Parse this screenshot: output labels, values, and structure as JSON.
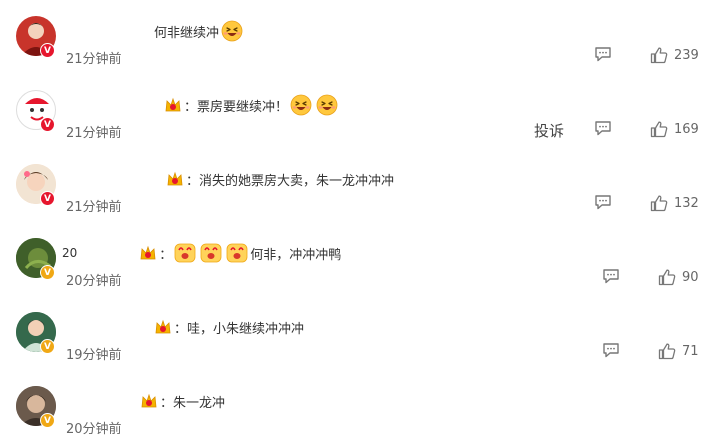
{
  "comments": [
    {
      "prefix": "",
      "text": "何非继续冲",
      "time": "21分钟前",
      "likes": "239",
      "badge": "V",
      "badge_color": "#e6162d"
    },
    {
      "prefix": "",
      "text": "：票房要继续冲！",
      "time": "21分钟前",
      "likes": "169",
      "badge": "V",
      "badge_color": "#e6162d",
      "report": "投诉"
    },
    {
      "prefix": "",
      "text": "：消失的她票房大卖，朱一龙冲冲冲",
      "time": "21分钟前",
      "likes": "132",
      "badge": "V",
      "badge_color": "#e6162d"
    },
    {
      "prefix": "20",
      "text": "：",
      "text2": "何非，冲冲冲鸭",
      "time": "20分钟前",
      "likes": "90",
      "badge": "V",
      "badge_color": "#f0a815"
    },
    {
      "prefix": "",
      "text": "：哇，小朱继续冲冲冲",
      "time": "19分钟前",
      "likes": "71",
      "badge": "V",
      "badge_color": "#f0a815"
    },
    {
      "prefix": "",
      "text": "：朱一龙冲",
      "time": "20分钟前",
      "badge": "V",
      "badge_color": "#f0a815"
    }
  ],
  "icons": {
    "reply": "comment-icon",
    "like": "thumb-up-icon",
    "emoji": "laughing-emoji-icon",
    "crown": "fan-crown-icon"
  }
}
